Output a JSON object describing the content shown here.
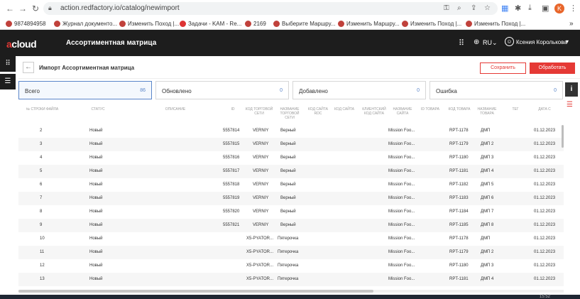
{
  "browser": {
    "url": "action.redfactory.io/catalog/newimport",
    "profile_initial": "K",
    "bookmarks": [
      "9874894958",
      "Журнал документо...",
      "Изменить Поход |...",
      "Задачи - KAM - Re...",
      "2169",
      "Выберите Маршру...",
      "Изменить Маршру...",
      "Изменить Поход |...",
      "Изменить Поход |..."
    ]
  },
  "header": {
    "logo_prefix": "a",
    "logo_text": "cloud",
    "app_title": "Ассортиментная матрица",
    "lang": "RU",
    "user_name": "Ксения Королькова"
  },
  "page": {
    "title": "Импорт Ассортиментная матрица",
    "save_label": "Сохранить",
    "process_label": "Обработать"
  },
  "tiles": [
    {
      "label": "Всего",
      "count": "86"
    },
    {
      "label": "Обновлено",
      "count": "0"
    },
    {
      "label": "Добавлено",
      "count": "0"
    },
    {
      "label": "Ошибка",
      "count": "0"
    }
  ],
  "table": {
    "columns": [
      "№ СТРОКИ ФАЙЛА",
      "СТАТУС",
      "ОПИСАНИЕ",
      "ID",
      "КОД ТОРГОВОЙ СЕТИ",
      "НАЗВАНИЕ ТОРГОВОЙ СЕТИ",
      "КОД САЙТА RDC",
      "КОД САЙТА",
      "КЛИЕНТСКИЙ КОД САЙТА",
      "НАЗВАНИЕ САЙТА",
      "ID ТОВАРА",
      "КОД ТОВАРА",
      "НАЗВАНИЕ ТОВАРА",
      "ТЕГ",
      "ДАТА С"
    ],
    "rows": [
      {
        "num": "2",
        "status": "Новый",
        "id": "5557814",
        "chain_code": "VERNIY",
        "chain_name": "Верный",
        "site": "Mission Foo...",
        "code": "RPT-1178",
        "name": "ДМП",
        "date": "01.12.2023"
      },
      {
        "num": "3",
        "status": "Новый",
        "id": "5557815",
        "chain_code": "VERNIY",
        "chain_name": "Верный",
        "site": "Mission Foo...",
        "code": "RPT-1179",
        "name": "ДМП 2",
        "date": "01.12.2023"
      },
      {
        "num": "4",
        "status": "Новый",
        "id": "5557816",
        "chain_code": "VERNIY",
        "chain_name": "Верный",
        "site": "Mission Foo...",
        "code": "RPT-1180",
        "name": "ДМП 3",
        "date": "01.12.2023"
      },
      {
        "num": "5",
        "status": "Новый",
        "id": "5557817",
        "chain_code": "VERNIY",
        "chain_name": "Верный",
        "site": "Mission Foo...",
        "code": "RPT-1181",
        "name": "ДМП 4",
        "date": "01.12.2023"
      },
      {
        "num": "6",
        "status": "Новый",
        "id": "5557818",
        "chain_code": "VERNIY",
        "chain_name": "Верный",
        "site": "Mission Foo...",
        "code": "RPT-1182",
        "name": "ДМП 5",
        "date": "01.12.2023"
      },
      {
        "num": "7",
        "status": "Новый",
        "id": "5557819",
        "chain_code": "VERNIY",
        "chain_name": "Верный",
        "site": "Mission Foo...",
        "code": "RPT-1183",
        "name": "ДМП 6",
        "date": "01.12.2023"
      },
      {
        "num": "8",
        "status": "Новый",
        "id": "5557820",
        "chain_code": "VERNIY",
        "chain_name": "Верный",
        "site": "Mission Foo...",
        "code": "RPT-1184",
        "name": "ДМП 7",
        "date": "01.12.2023"
      },
      {
        "num": "9",
        "status": "Новый",
        "id": "5557821",
        "chain_code": "VERNIY",
        "chain_name": "Верный",
        "site": "Mission Foo...",
        "code": "RPT-1185",
        "name": "ДМП 8",
        "date": "01.12.2023"
      },
      {
        "num": "10",
        "status": "Новый",
        "id": "",
        "chain_code": "X5-PYATOR...",
        "chain_name": "Пятерочка",
        "site": "Mission Foo...",
        "code": "RPT-1178",
        "name": "ДМП",
        "date": "01.12.2023"
      },
      {
        "num": "11",
        "status": "Новый",
        "id": "",
        "chain_code": "X5-PYATOR...",
        "chain_name": "Пятерочка",
        "site": "Mission Foo...",
        "code": "RPT-1179",
        "name": "ДМП 2",
        "date": "01.12.2023"
      },
      {
        "num": "12",
        "status": "Новый",
        "id": "",
        "chain_code": "X5-PYATOR...",
        "chain_name": "Пятерочка",
        "site": "Mission Foo...",
        "code": "RPT-1180",
        "name": "ДМП 3",
        "date": "01.12.2023"
      },
      {
        "num": "13",
        "status": "Новый",
        "id": "",
        "chain_code": "X5-PYATOR...",
        "chain_name": "Пятерочка",
        "site": "Mission Foo...",
        "code": "RPT-1181",
        "name": "ДМП 4",
        "date": "01.12.2023"
      }
    ]
  },
  "taskbar": {
    "time": "15:52"
  }
}
